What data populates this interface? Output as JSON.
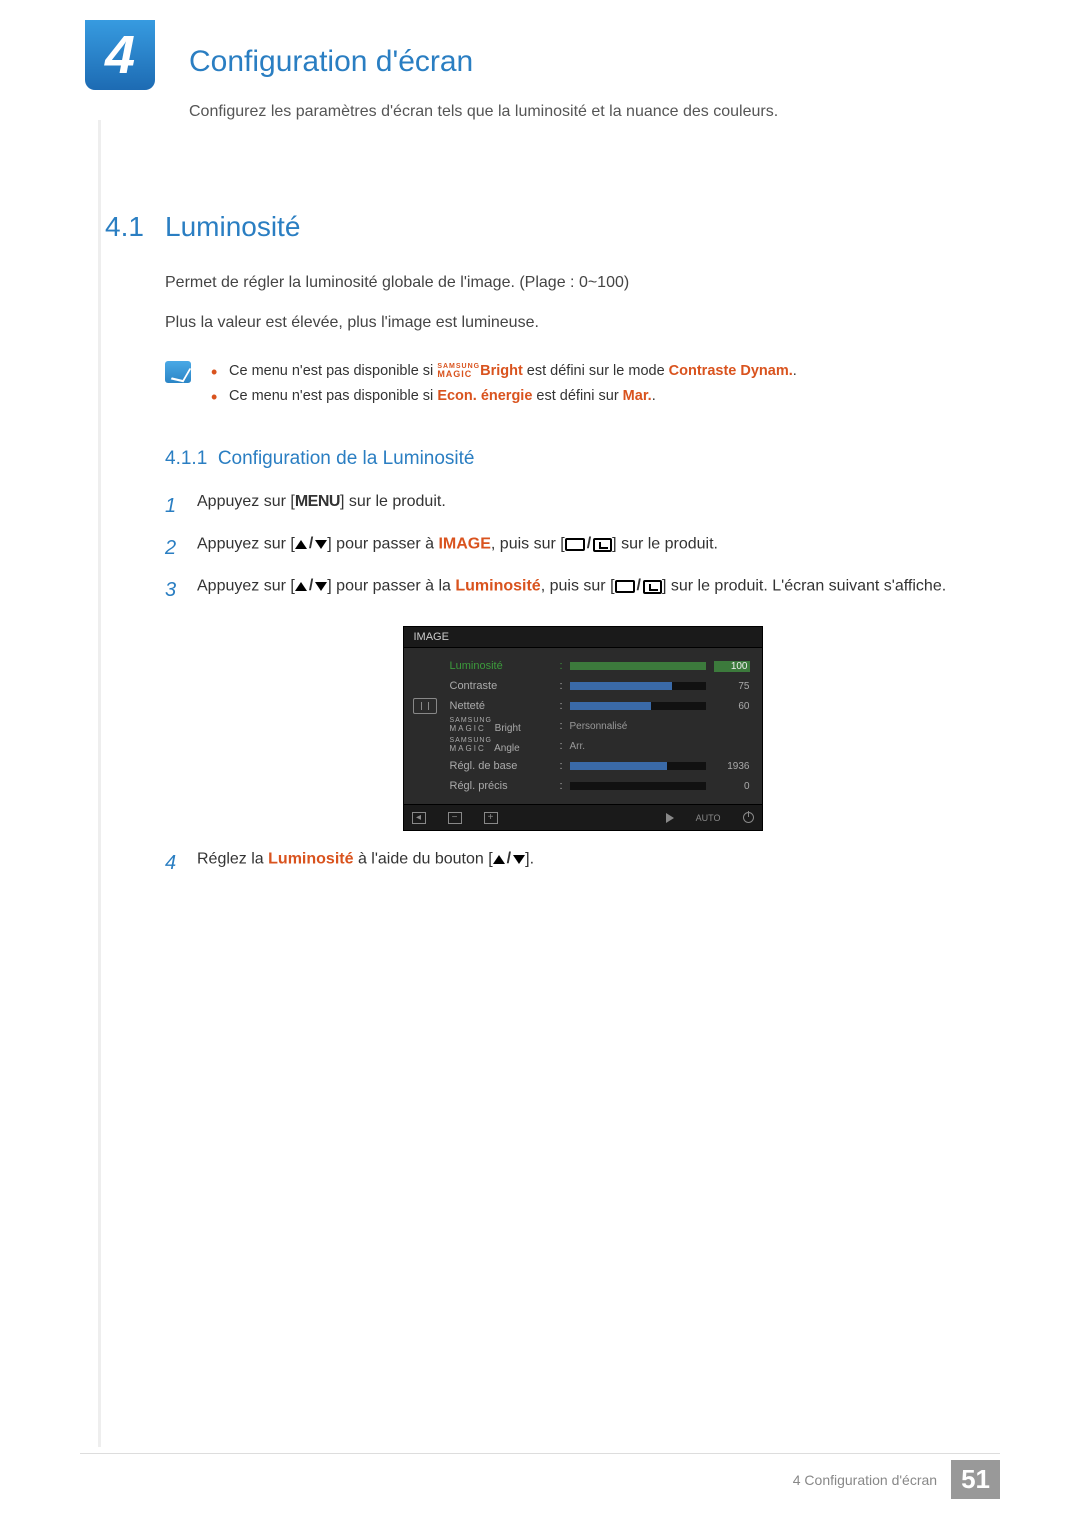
{
  "chapter": {
    "number": "4",
    "title": "Configuration d'écran",
    "intro": "Configurez les paramètres d'écran tels que la luminosité et la nuance des couleurs."
  },
  "section": {
    "num": "4.1",
    "title": "Luminosité",
    "p1": "Permet de régler la luminosité globale de l'image. (Plage : 0~100)",
    "p2": "Plus la valeur est élevée, plus l'image est lumineuse."
  },
  "notes": {
    "n1a": "Ce menu n'est pas disponible si ",
    "n1_magic_top": "SAMSUNG",
    "n1_magic_bottom": "MAGIC",
    "n1_bright": "Bright",
    "n1b": " est défini sur le mode ",
    "n1_mode": "Contraste Dynam.",
    "n1c": ".",
    "n2a": "Ce menu n'est pas disponible si ",
    "n2_mode": "Econ. énergie",
    "n2b": " est défini sur ",
    "n2_val": "Mar.",
    "n2c": "."
  },
  "subsection": {
    "num": "4.1.1",
    "title": "Configuration de la Luminosité"
  },
  "steps": {
    "s1": {
      "n": "1",
      "a": "Appuyez sur [",
      "menu": "MENU",
      "b": "] sur le produit."
    },
    "s2": {
      "n": "2",
      "a": "Appuyez sur [",
      "b": "] pour passer à ",
      "img": "IMAGE",
      "c": ", puis sur [",
      "d": "] sur le produit."
    },
    "s3": {
      "n": "3",
      "a": "Appuyez sur [",
      "b": "] pour passer à la ",
      "lum": "Luminosité",
      "c": ", puis sur [",
      "d": "] sur le produit. L'écran suivant s'affiche."
    },
    "s4": {
      "n": "4",
      "a": "Réglez la ",
      "lum": "Luminosité",
      "b": " à l'aide du bouton [",
      "c": "]."
    }
  },
  "osd": {
    "title": "IMAGE",
    "rows": [
      {
        "label": "Luminosité",
        "type": "bar",
        "value": 100,
        "max": 100,
        "selected": true
      },
      {
        "label": "Contraste",
        "type": "bar",
        "value": 75,
        "max": 100
      },
      {
        "label": "Netteté",
        "type": "bar",
        "value": 60,
        "max": 100
      },
      {
        "label_magic": {
          "top": "SAMSUNG",
          "bottom": "MAGIC",
          "suffix": " Bright"
        },
        "type": "text",
        "text": "Personnalisé"
      },
      {
        "label_magic": {
          "top": "SAMSUNG",
          "bottom": "MAGIC",
          "suffix": " Angle"
        },
        "type": "text",
        "text": "Arr."
      },
      {
        "label": "Régl. de base",
        "type": "bar",
        "value": 72,
        "max": 100,
        "display": "1936"
      },
      {
        "label": "Régl. précis",
        "type": "bar",
        "value": 0,
        "max": 100,
        "display": "0"
      }
    ],
    "nav_auto": "AUTO"
  },
  "footer": {
    "label": "4 Configuration d'écran",
    "page": "51"
  }
}
